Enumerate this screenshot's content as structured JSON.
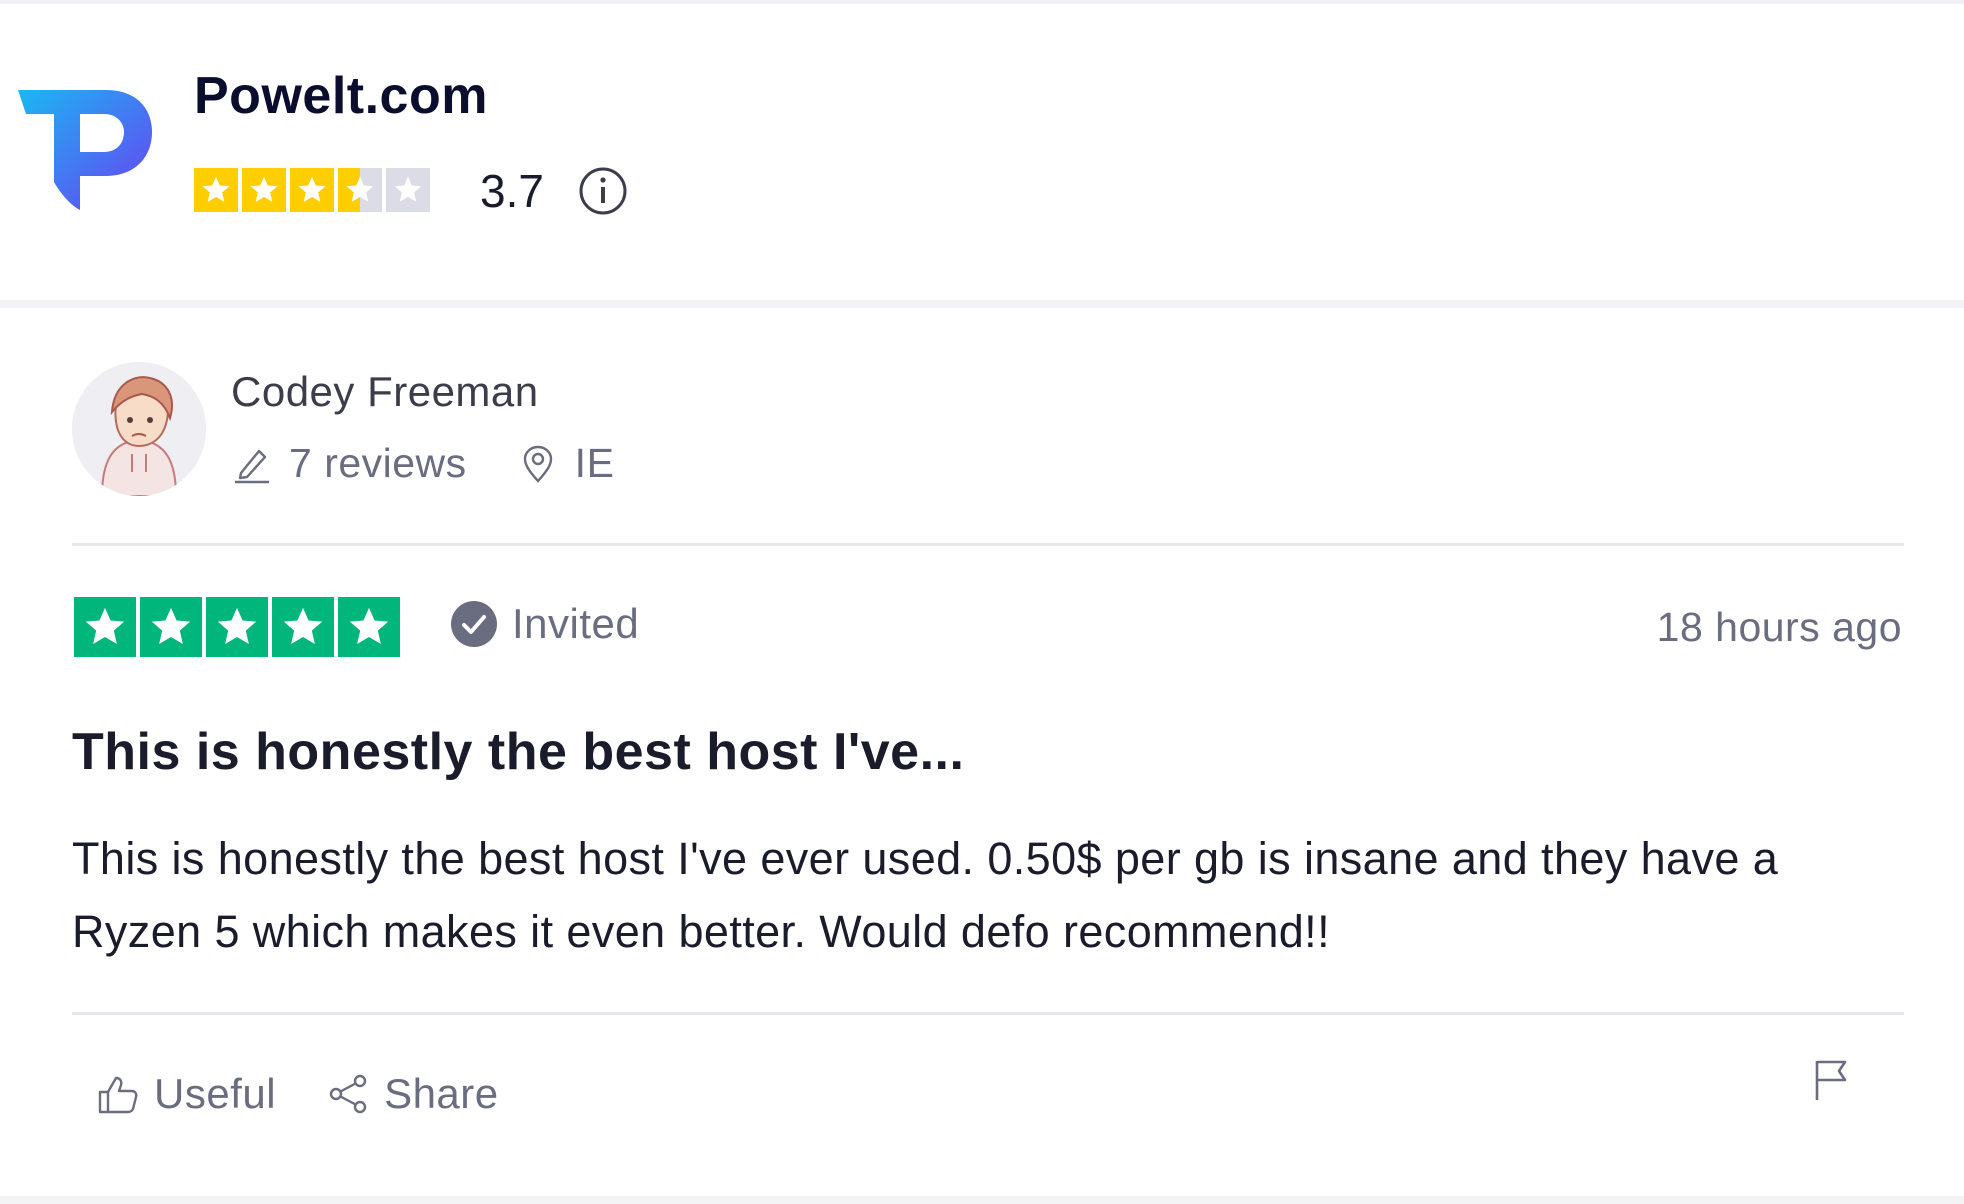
{
  "business": {
    "name": "Powelt.com",
    "logo_text": "POWELT.COM",
    "rating": "3.7",
    "stars": 3.5
  },
  "review": {
    "reviewer": {
      "name": "Codey Freeman",
      "reviews_count": "7 reviews",
      "country": "IE"
    },
    "stars": 5,
    "invited_label": "Invited",
    "date": "18 hours ago",
    "title": "This is honestly the best host I've...",
    "body": "This is honestly the best host I've ever used. 0.50$ per gb is insane and they have a Ryzen 5 which makes it even better. Would defo recommend!!"
  },
  "actions": {
    "useful_label": "Useful",
    "share_label": "Share"
  },
  "colors": {
    "brand_star": "#ffce00",
    "review_star": "#00b67a",
    "text_muted": "#6a6c80",
    "logo_blue": "#1e9bf0",
    "logo_purple": "#5b4cf0"
  },
  "icons": [
    "powelt-logo",
    "info-icon",
    "pencil-icon",
    "location-pin-icon",
    "verified-check-icon",
    "thumbs-up-icon",
    "share-icon",
    "flag-icon"
  ]
}
